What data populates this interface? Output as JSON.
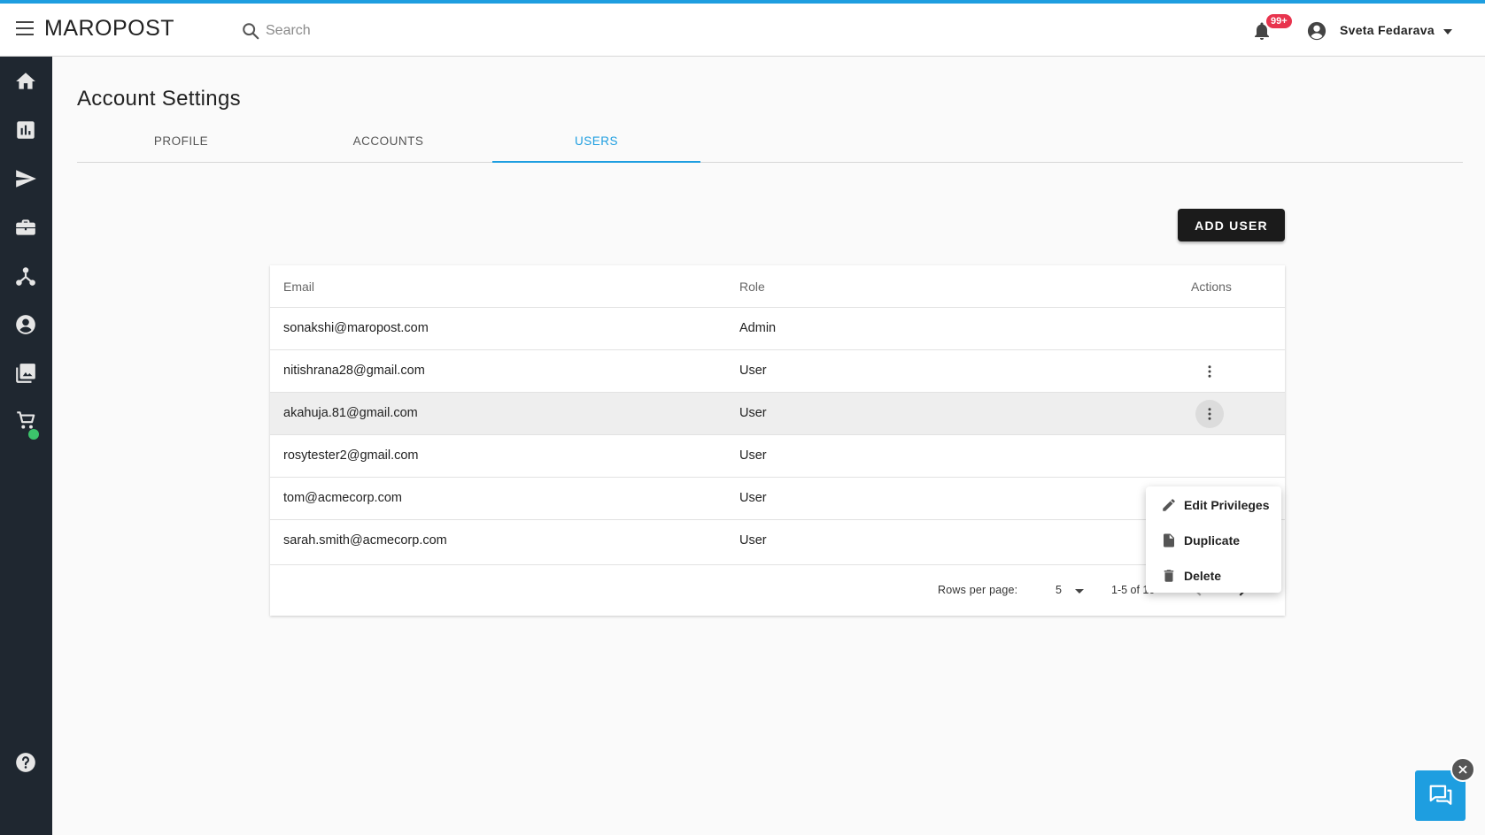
{
  "app": {
    "logo": "MAROPOST"
  },
  "search": {
    "placeholder": "Search"
  },
  "header": {
    "notification_count": "99+",
    "user_name": "Sveta Fedarava"
  },
  "sidebar": {
    "items": [
      {
        "icon": "home-icon"
      },
      {
        "icon": "analytics-icon"
      },
      {
        "icon": "send-icon"
      },
      {
        "icon": "briefcase-icon"
      },
      {
        "icon": "network-icon"
      },
      {
        "icon": "account-icon"
      },
      {
        "icon": "gallery-icon"
      },
      {
        "icon": "cart-icon"
      },
      {
        "icon": "help-icon"
      }
    ]
  },
  "page": {
    "title": "Account Settings"
  },
  "tabs": [
    {
      "label": "PROFILE"
    },
    {
      "label": "ACCOUNTS"
    },
    {
      "label": "USERS",
      "active": true
    }
  ],
  "toolbar": {
    "add_user_label": "ADD USER"
  },
  "table": {
    "columns": [
      "Email",
      "Role",
      "Actions"
    ],
    "rows": [
      {
        "email": "sonakshi@maropost.com",
        "role": "Admin"
      },
      {
        "email": "nitishrana28@gmail.com",
        "role": "User"
      },
      {
        "email": "akahuja.81@gmail.com",
        "role": "User"
      },
      {
        "email": "rosytester2@gmail.com",
        "role": "User"
      },
      {
        "email": "tom@acmecorp.com",
        "role": "User"
      },
      {
        "email": "sarah.smith@acmecorp.com",
        "role": "User"
      }
    ]
  },
  "pagination": {
    "rows_per_page_label": "Rows per page:",
    "rows_per_page": "5",
    "range": "1-5 of 10"
  },
  "context_menu": {
    "items": [
      {
        "label": "Edit Privileges",
        "icon": "pencil-icon"
      },
      {
        "label": "Duplicate",
        "icon": "document-icon"
      },
      {
        "label": "Delete",
        "icon": "trash-icon"
      }
    ]
  },
  "colors": {
    "accent": "#1e9ee0",
    "sidebar": "#1f2730",
    "badge": "#e8344e",
    "button": "#1b1b1b"
  }
}
